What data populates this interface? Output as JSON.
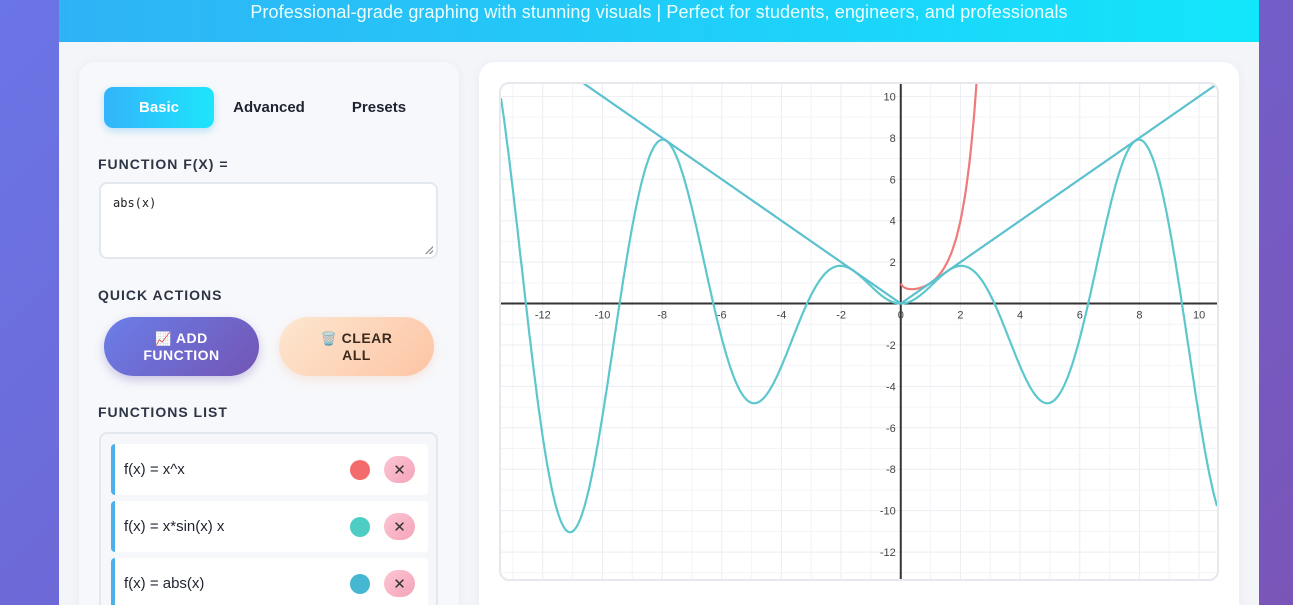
{
  "header": {
    "subtitle": "Professional-grade graphing with stunning visuals | Perfect for students, engineers, and professionals"
  },
  "tabs": [
    {
      "label": "Basic",
      "active": true
    },
    {
      "label": "Advanced",
      "active": false
    },
    {
      "label": "Presets",
      "active": false
    }
  ],
  "function_input": {
    "label": "FUNCTION F(X) =",
    "value": "abs(x)"
  },
  "quick_actions": {
    "label": "QUICK ACTIONS",
    "add_icon": "📈",
    "add_label": "ADD FUNCTION",
    "clear_icon": "🗑️",
    "clear_label": "CLEAR ALL"
  },
  "functions_list": {
    "label": "FUNCTIONS LIST",
    "items": [
      {
        "text": "f(x) = x^x",
        "color": "#f36b6b",
        "remove": "✕"
      },
      {
        "text": "f(x) = x*sin(x) x",
        "color": "#4ecdc4",
        "remove": "✕"
      },
      {
        "text": "f(x) = abs(x)",
        "color": "#45b7d1",
        "remove": "✕"
      }
    ]
  },
  "chart_data": {
    "type": "line",
    "xlim": [
      -13.4,
      10.6
    ],
    "ylim": [
      -13.3,
      10.6
    ],
    "x_ticks": [
      -12,
      -10,
      -8,
      -6,
      -4,
      -2,
      0,
      2,
      4,
      6,
      8,
      10
    ],
    "y_ticks": [
      10,
      8,
      6,
      4,
      2,
      -2,
      -4,
      -6,
      -8,
      -10,
      -12
    ],
    "grid": true,
    "series": [
      {
        "expr": "x^x",
        "color": "#f07a7a"
      },
      {
        "expr": "x*sin(x)",
        "color": "#5cc8cc"
      },
      {
        "expr": "abs(x)",
        "color": "#5cc1cf"
      }
    ]
  }
}
